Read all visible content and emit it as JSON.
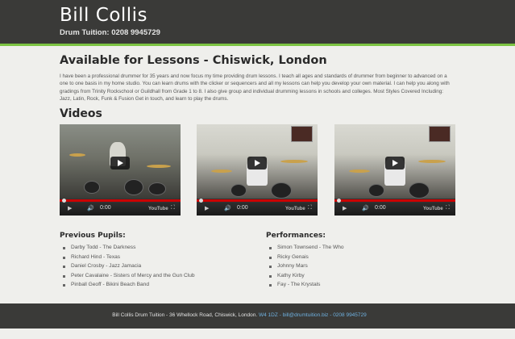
{
  "header": {
    "title": "Bill Collis",
    "subtitle": "Drum Tuition: 0208 9945729"
  },
  "main": {
    "heading": "Available for Lessons - Chiswick, London",
    "intro": "I have been a professional drummer for 35 years and now focus my time providing drum lessons. I teach all ages and standards of drummer from beginner to advanced on a one to one basis in my home studio. You can learn drums with the clicker or sequencers and all my lessons can help you develop your own material. I can help you along with gradings from Trinity Rockschool or Guildhall from Grade 1 to 8. I also give group and individual drumming lessons in schools and colleges. Most Styles Covered Including: Jazz, Latin, Rock, Funk & Fusion Get in touch, and learn to play the drums.",
    "videos_heading": "Videos",
    "videos": [
      {
        "time": "0:00",
        "brand": "YouTube"
      },
      {
        "time": "0:00",
        "brand": "YouTube"
      },
      {
        "time": "0:00",
        "brand": "YouTube"
      }
    ]
  },
  "pupils": {
    "heading": "Previous Pupils:",
    "items": [
      "Darby Todd - The Darkness",
      "Richard Hind - Texas",
      "Daniel Crosby - Jazz Jamacia",
      "Peter Cavalaine - Sisters of Mercy and the Gun Club",
      "Pinball Geoff - Bikini Beach Band"
    ]
  },
  "performances": {
    "heading": "Performances:",
    "items": [
      "Simon Townsend - The Who",
      "Ricky Genais",
      "Johnny Mars",
      "Kathy Kirby",
      "Fay - The Krystals"
    ]
  },
  "footer": {
    "text": "Bill Collis Drum Tuition - 36 Whellock Road, Chiswick, London.",
    "postcode": "W4 1DZ",
    "sep1": " - ",
    "email": "bill@drumtuition.biz",
    "sep2": " - ",
    "phone": "0208 9945729"
  },
  "colors": {
    "accent": "#7cc443",
    "header_bg": "#3a3a38",
    "link": "#6fb1e0"
  }
}
